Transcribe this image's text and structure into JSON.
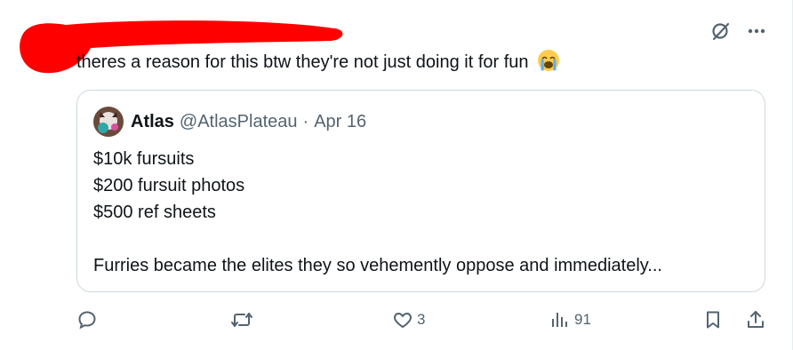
{
  "tweet": {
    "text": "theres a reason for this btw they're not just doing it for fun",
    "emoji_icon": "loudly-crying-face-icon"
  },
  "quote": {
    "name": "Atlas",
    "handle": "@AtlasPlateau",
    "separator": "·",
    "date": "Apr 16",
    "lines": [
      "$10k fursuits",
      "$200 fursuit photos",
      "$500 ref sheets",
      "",
      "Furries became the elites they so vehemently oppose and immediately..."
    ]
  },
  "actions": {
    "likes": "3",
    "views": "91"
  },
  "colors": {
    "text": "#0f1419",
    "muted": "#536471",
    "border": "#cfd9de",
    "redaction": "#ff0000"
  }
}
